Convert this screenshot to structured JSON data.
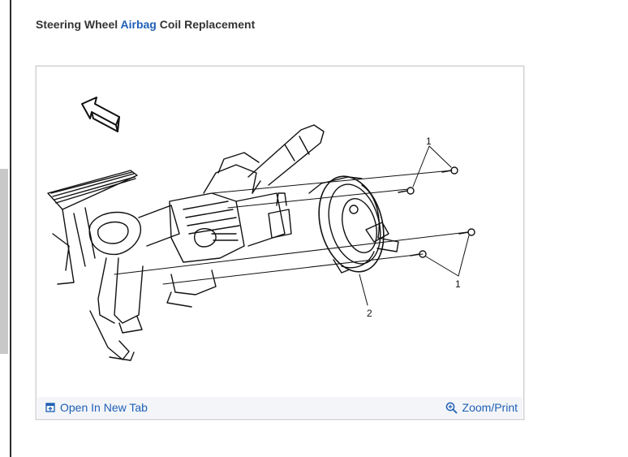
{
  "page": {
    "title_parts": [
      "Steering Wheel ",
      "Airbag",
      " Coil Replacement"
    ],
    "accent_color": "#1f5fb5"
  },
  "figure": {
    "callouts": [
      "1",
      "1",
      "2"
    ],
    "footer": {
      "open_label": "Open In New Tab",
      "open_icon": "open-in-new-tab-icon",
      "zoom_label": "Zoom/Print",
      "zoom_icon": "zoom-in-icon"
    }
  }
}
